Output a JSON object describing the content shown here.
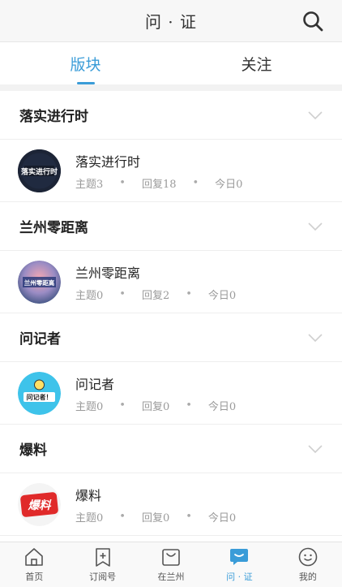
{
  "header": {
    "title": "问 · 证",
    "search_icon": "search-icon"
  },
  "tabs": [
    {
      "label": "版块",
      "active": true
    },
    {
      "label": "关注",
      "active": false
    }
  ],
  "sections": [
    {
      "title": "落实进行时",
      "forum": {
        "name": "落实进行时",
        "topics": "主题3",
        "replies": "回复18",
        "today": "今日0",
        "avatar_text": "落实进行时"
      }
    },
    {
      "title": "兰州零距离",
      "forum": {
        "name": "兰州零距离",
        "topics": "主题0",
        "replies": "回复2",
        "today": "今日0",
        "avatar_text": "兰州零距离"
      }
    },
    {
      "title": "问记者",
      "forum": {
        "name": "问记者",
        "topics": "主题0",
        "replies": "回复0",
        "today": "今日0",
        "avatar_text": "问记者！"
      }
    },
    {
      "title": "爆料",
      "forum": {
        "name": "爆料",
        "topics": "主题0",
        "replies": "回复0",
        "today": "今日0",
        "avatar_text": "爆料"
      }
    }
  ],
  "bottom_nav": [
    {
      "label": "首页",
      "icon": "home-icon"
    },
    {
      "label": "订阅号",
      "icon": "subscribe-icon"
    },
    {
      "label": "在兰州",
      "icon": "bag-icon"
    },
    {
      "label": "问 · 证",
      "icon": "chat-icon",
      "active": true
    },
    {
      "label": "我的",
      "icon": "smile-icon"
    }
  ],
  "colors": {
    "accent": "#3a9cd8",
    "text": "#222222",
    "muted": "#9a9a9a"
  }
}
